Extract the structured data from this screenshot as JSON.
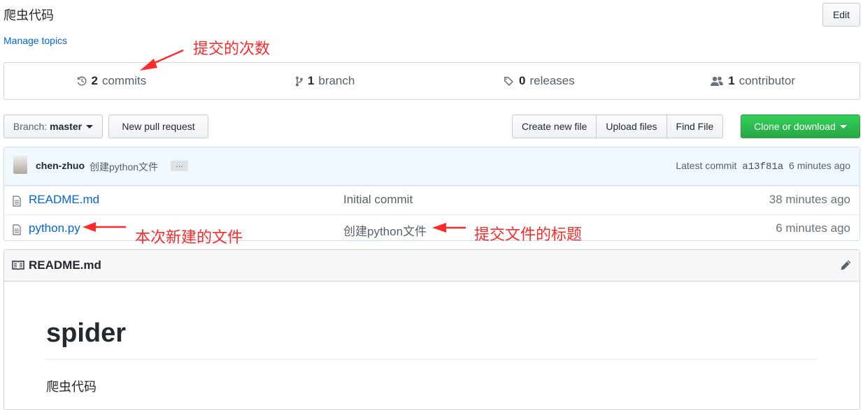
{
  "repo": {
    "description": "爬虫代码",
    "manage_topics": "Manage topics",
    "edit": "Edit"
  },
  "summary": {
    "commits_num": "2",
    "commits_label": "commits",
    "branch_num": "1",
    "branch_label": "branch",
    "releases_num": "0",
    "releases_label": "releases",
    "contributor_num": "1",
    "contributor_label": "contributor"
  },
  "toolbar": {
    "branch_prefix": "Branch:",
    "branch_name": "master",
    "new_pull_request": "New pull request",
    "create_new_file": "Create new file",
    "upload_files": "Upload files",
    "find_file": "Find File",
    "clone_or_download": "Clone or download"
  },
  "latest_commit": {
    "author": "chen-zhuo",
    "message": "创建python文件",
    "ellipsis": "…",
    "label": "Latest commit",
    "sha": "a13f81a",
    "age": "6 minutes ago"
  },
  "files": [
    {
      "name": "README.md",
      "message": "Initial commit",
      "age": "38 minutes ago",
      "icon": "file-icon"
    },
    {
      "name": "python.py",
      "message": "创建python文件",
      "age": "6 minutes ago",
      "icon": "file-icon"
    }
  ],
  "readme": {
    "title": "README.md",
    "heading": "spider",
    "body": "爬虫代码"
  },
  "annotations": {
    "commits": "提交的次数",
    "new_file": "本次新建的文件",
    "commit_title": "提交文件的标题"
  },
  "colors": {
    "link": "#0366d6",
    "annotation_red": "#ff2a2a",
    "clone_green": "#28a745",
    "commit_bar_bg": "#f1f8ff"
  }
}
